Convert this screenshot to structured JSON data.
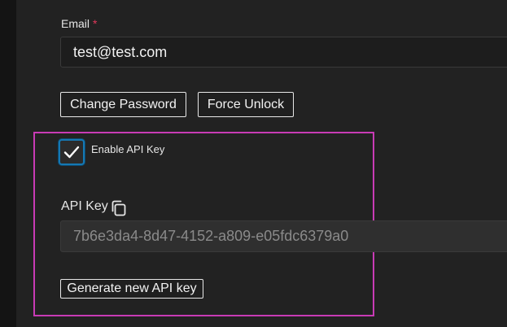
{
  "form": {
    "email": {
      "label": "Email",
      "required_marker": "*",
      "value": "test@test.com"
    },
    "buttons": {
      "change_password": "Change Password",
      "force_unlock": "Force Unlock"
    },
    "api": {
      "enable_label": "Enable API Key",
      "enabled": true,
      "key_label": "API Key",
      "key_value": "7b6e3da4-8d47-4152-a809-e05fdc6379a0",
      "generate_label": "Generate new API key"
    }
  },
  "colors": {
    "highlight_border": "#c83bb5",
    "checkbox_focus": "#1578b3",
    "required": "#e0385a"
  },
  "icons": {
    "checkbox": "checkmark-icon",
    "copy": "copy-icon"
  }
}
